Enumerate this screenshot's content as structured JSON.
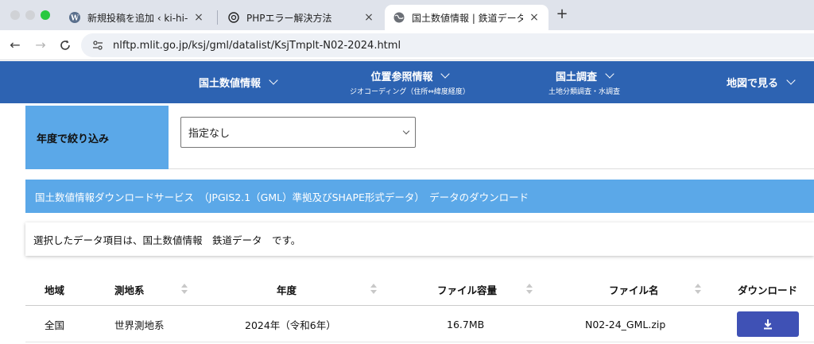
{
  "browser": {
    "tabs": [
      {
        "title": "新規投稿を追加 ‹ ki-hi-ro.com —",
        "icon": "wordpress-icon"
      },
      {
        "title": "PHPエラー解決方法",
        "icon": "chatgpt-icon"
      },
      {
        "title": "国土数値情報 | 鉄道データ",
        "icon": "globe-icon"
      }
    ],
    "url": "nlftp.mlit.go.jp/ksj/gml/datalist/KsjTmplt-N02-2024.html"
  },
  "site_nav": [
    {
      "label": "国土数値情報",
      "sub": ""
    },
    {
      "label": "位置参照情報",
      "sub": "ジオコーディング（住所⇔緯度経度）"
    },
    {
      "label": "国土調査",
      "sub": "土地分類調査・水調査"
    },
    {
      "label": "地図で見る",
      "sub": ""
    }
  ],
  "filter": {
    "label": "年度で絞り込み",
    "selected": "指定なし"
  },
  "banner": "国土数値情報ダウンロードサービス　（JPGIS2.1（GML）準拠及びSHAPE形式データ）　データのダウンロード",
  "notice": "選択したデータ項目は、国土数値情報　鉄道データ　です。",
  "table": {
    "headers": [
      "地域",
      "測地系",
      "年度",
      "ファイル容量",
      "ファイル名",
      "ダウンロード"
    ],
    "rows": [
      {
        "region": "全国",
        "datum": "世界測地系",
        "year": "2024年（令和6年）",
        "size": "16.7MB",
        "filename": "N02-24_GML.zip"
      }
    ]
  },
  "colors": {
    "nav_blue": "#2d63b2",
    "light_blue": "#5ba8e8",
    "download_button": "#3f51b5"
  }
}
